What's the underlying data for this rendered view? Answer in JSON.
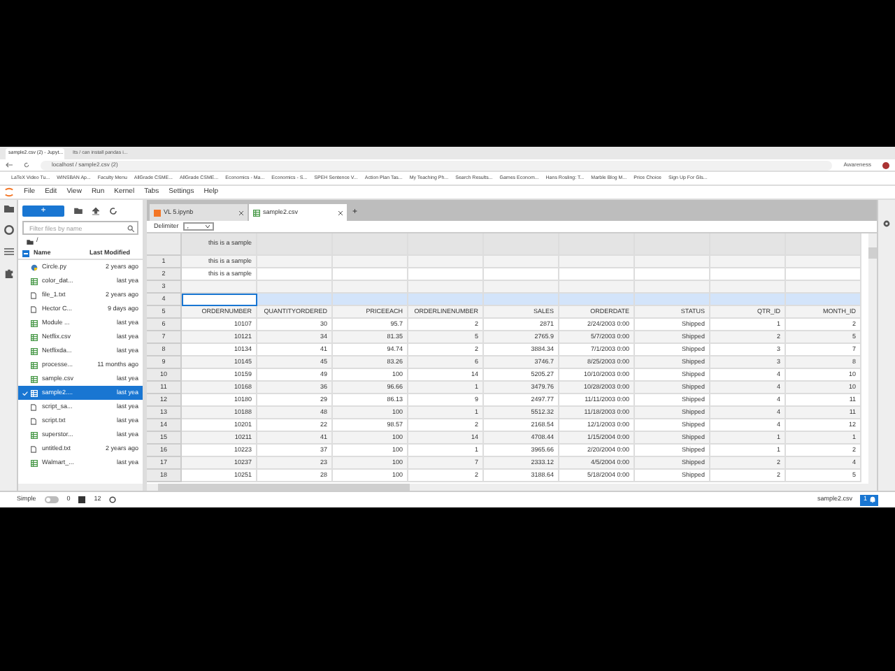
{
  "browser": {
    "tabs": [
      {
        "title": "sample2.csv (2) - Jupyt...",
        "selected": true
      },
      {
        "title": "Its / can install pandas i...",
        "selected": false
      }
    ],
    "address": "localhost / sample2.csv (2)",
    "profile": "Awareness",
    "bookmarks": [
      "LaTeX Video Tu...",
      "WINSBAN Ap...",
      "Faculty Menu",
      "AllGrade CSME...",
      "AllGrade CSME...",
      "Economics - Ma...",
      "Economics - S...",
      "SPEH Sentence V...",
      "Action Plan Tas...",
      "My Teaching Ph...",
      "Search Results...",
      "Games Econom...",
      "Hans Rosling: T...",
      "Marble Blog M...",
      "Price Choice",
      "Sign Up For Gls..."
    ]
  },
  "menu": [
    "File",
    "Edit",
    "View",
    "Run",
    "Kernel",
    "Tabs",
    "Settings",
    "Help"
  ],
  "file_browser": {
    "new_button": "+",
    "search": {
      "placeholder": "Filter files by name"
    },
    "path": "/",
    "columns": [
      "Name",
      "Last Modified"
    ],
    "select_all_partial": true,
    "items": [
      {
        "name": "Circle.py",
        "modified": "2 years ago",
        "kind": "py",
        "selected": false
      },
      {
        "name": "color_dat...",
        "modified": "last yea",
        "kind": "csv",
        "selected": false
      },
      {
        "name": "file_1.txt",
        "modified": "2 years ago",
        "kind": "txt",
        "selected": false
      },
      {
        "name": "Hector C...",
        "modified": "9 days ago",
        "kind": "txt",
        "selected": false
      },
      {
        "name": "Module ...",
        "modified": "last yea",
        "kind": "csv",
        "selected": false
      },
      {
        "name": "Netflix.csv",
        "modified": "last yea",
        "kind": "csv",
        "selected": false
      },
      {
        "name": "Netflixda...",
        "modified": "last yea",
        "kind": "csv",
        "selected": false
      },
      {
        "name": "processe...",
        "modified": "11 months ago",
        "kind": "csv",
        "selected": false
      },
      {
        "name": "sample.csv",
        "modified": "last yea",
        "kind": "csv",
        "selected": false
      },
      {
        "name": "sample2....",
        "modified": "last yea",
        "kind": "csv",
        "selected": true
      },
      {
        "name": "script_sa...",
        "modified": "last yea",
        "kind": "txt",
        "selected": false
      },
      {
        "name": "script.txt",
        "modified": "last yea",
        "kind": "txt",
        "selected": false
      },
      {
        "name": "superstor...",
        "modified": "last yea",
        "kind": "csv",
        "selected": false
      },
      {
        "name": "untitled.txt",
        "modified": "2 years ago",
        "kind": "txt",
        "selected": false
      },
      {
        "name": "Walmart_...",
        "modified": "last yea",
        "kind": "csv",
        "selected": false
      }
    ]
  },
  "editor_tabs": [
    {
      "title": "VL 5.ipynb",
      "kind": "notebook",
      "selected": false
    },
    {
      "title": "sample2.csv",
      "kind": "csv",
      "selected": true
    }
  ],
  "new_tab": "+",
  "toolbar": {
    "label": "Delimiter",
    "value": ","
  },
  "grid": {
    "header": [
      "this is a sample"
    ],
    "rows": [
      {
        "number": "1",
        "cells": [
          "this is a sample"
        ],
        "selected": false
      },
      {
        "number": "2",
        "cells": [
          "this is a sample"
        ],
        "selected": false
      },
      {
        "number": "3",
        "cells": [],
        "selected": false
      },
      {
        "number": "4",
        "cells": [],
        "selected": true
      },
      {
        "number": "5",
        "cells": [
          "ORDERNUMBER",
          "QUANTITYORDERED",
          "PRICEEACH",
          "ORDERLINENUMBER",
          "SALES",
          "ORDERDATE",
          "STATUS",
          "QTR_ID",
          "MONTH_ID"
        ],
        "selected": false
      },
      {
        "number": "6",
        "cells": [
          "10107",
          "30",
          "95.7",
          "2",
          "2871",
          "2/24/2003 0:00",
          "Shipped",
          "1",
          "2"
        ],
        "selected": false
      },
      {
        "number": "7",
        "cells": [
          "10121",
          "34",
          "81.35",
          "5",
          "2765.9",
          "5/7/2003 0:00",
          "Shipped",
          "2",
          "5"
        ],
        "selected": false
      },
      {
        "number": "8",
        "cells": [
          "10134",
          "41",
          "94.74",
          "2",
          "3884.34",
          "7/1/2003 0:00",
          "Shipped",
          "3",
          "7"
        ],
        "selected": false
      },
      {
        "number": "9",
        "cells": [
          "10145",
          "45",
          "83.26",
          "6",
          "3746.7",
          "8/25/2003 0:00",
          "Shipped",
          "3",
          "8"
        ],
        "selected": false
      },
      {
        "number": "10",
        "cells": [
          "10159",
          "49",
          "100",
          "14",
          "5205.27",
          "10/10/2003 0:00",
          "Shipped",
          "4",
          "10"
        ],
        "selected": false
      },
      {
        "number": "11",
        "cells": [
          "10168",
          "36",
          "96.66",
          "1",
          "3479.76",
          "10/28/2003 0:00",
          "Shipped",
          "4",
          "10"
        ],
        "selected": false
      },
      {
        "number": "12",
        "cells": [
          "10180",
          "29",
          "86.13",
          "9",
          "2497.77",
          "11/11/2003 0:00",
          "Shipped",
          "4",
          "11"
        ],
        "selected": false
      },
      {
        "number": "13",
        "cells": [
          "10188",
          "48",
          "100",
          "1",
          "5512.32",
          "11/18/2003 0:00",
          "Shipped",
          "4",
          "11"
        ],
        "selected": false
      },
      {
        "number": "14",
        "cells": [
          "10201",
          "22",
          "98.57",
          "2",
          "2168.54",
          "12/1/2003 0:00",
          "Shipped",
          "4",
          "12"
        ],
        "selected": false
      },
      {
        "number": "15",
        "cells": [
          "10211",
          "41",
          "100",
          "14",
          "4708.44",
          "1/15/2004 0:00",
          "Shipped",
          "1",
          "1"
        ],
        "selected": false
      },
      {
        "number": "16",
        "cells": [
          "10223",
          "37",
          "100",
          "1",
          "3965.66",
          "2/20/2004 0:00",
          "Shipped",
          "1",
          "2"
        ],
        "selected": false
      },
      {
        "number": "17",
        "cells": [
          "10237",
          "23",
          "100",
          "7",
          "2333.12",
          "4/5/2004 0:00",
          "Shipped",
          "2",
          "4"
        ],
        "selected": false
      },
      {
        "number": "18",
        "cells": [
          "10251",
          "28",
          "100",
          "2",
          "3188.64",
          "5/18/2004 0:00",
          "Shipped",
          "2",
          "5"
        ],
        "selected": false
      }
    ]
  },
  "status_bar": {
    "mode": "Simple",
    "simple_on": false,
    "kernels": "0",
    "terminals": "12",
    "file": "sample2.csv",
    "notifications": "1"
  }
}
